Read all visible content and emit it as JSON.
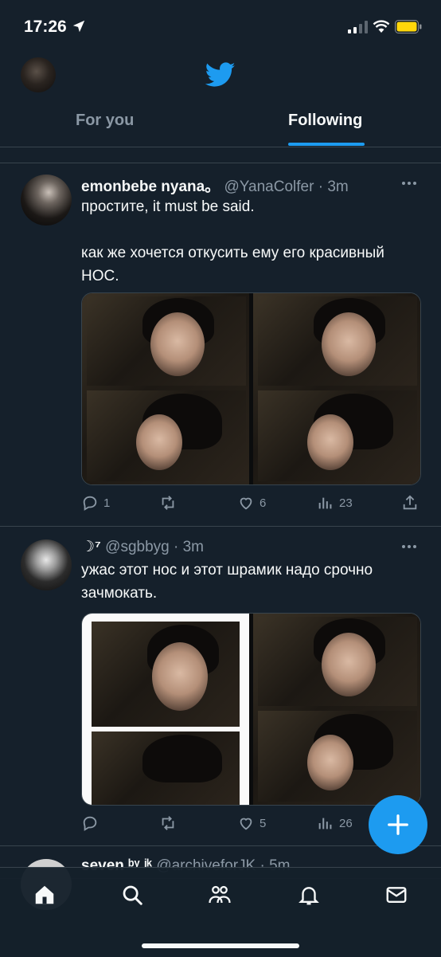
{
  "status_bar": {
    "time": "17:26"
  },
  "header": {
    "tabs": [
      {
        "label": "For you",
        "selected": false
      },
      {
        "label": "Following",
        "selected": true
      }
    ],
    "accent_color": "#1d9bf0"
  },
  "tweets": [
    {
      "display_name": "emonbebe nyana。",
      "handle_time": "@YanaColfer · 3m",
      "text": "простите, it must be said.\n\nкак же хочется откусить ему его красивный НОС.",
      "replies": "1",
      "retweets": "",
      "likes": "6",
      "views": "23"
    },
    {
      "display_name": "☽⁷",
      "handle_time": "@sgbbyg · 3m",
      "text": "ужас этот нос и этот шрамик надо срочно зачмокать.",
      "replies": "",
      "retweets": "",
      "likes": "5",
      "views": "26"
    },
    {
      "display_name": "seven ᵇʸ ʲᵏ",
      "handle_time": "@archiveforJK · 5m"
    }
  ],
  "icons": {
    "compose": "plus-icon",
    "tabbar": [
      "home-icon",
      "search-icon",
      "communities-icon",
      "notifications-icon",
      "messages-icon"
    ]
  }
}
